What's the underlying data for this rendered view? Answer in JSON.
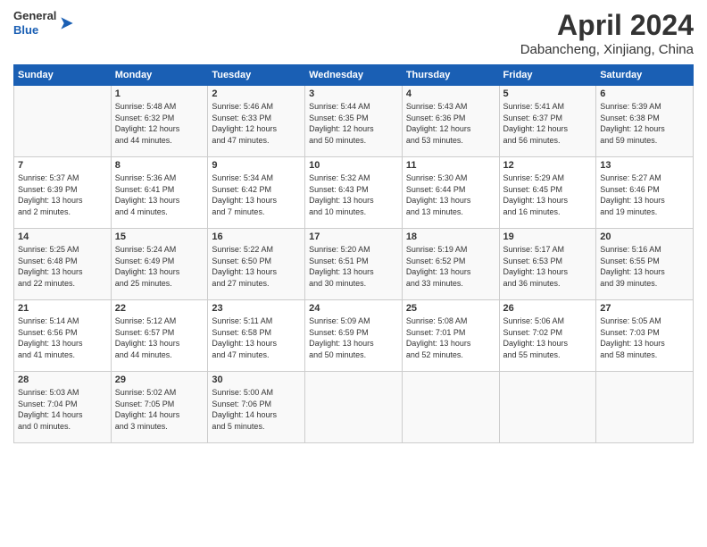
{
  "header": {
    "logo_general": "General",
    "logo_blue": "Blue",
    "month_title": "April 2024",
    "subtitle": "Dabancheng, Xinjiang, China"
  },
  "days_of_week": [
    "Sunday",
    "Monday",
    "Tuesday",
    "Wednesday",
    "Thursday",
    "Friday",
    "Saturday"
  ],
  "weeks": [
    [
      {
        "day": "",
        "content": ""
      },
      {
        "day": "1",
        "content": "Sunrise: 5:48 AM\nSunset: 6:32 PM\nDaylight: 12 hours\nand 44 minutes."
      },
      {
        "day": "2",
        "content": "Sunrise: 5:46 AM\nSunset: 6:33 PM\nDaylight: 12 hours\nand 47 minutes."
      },
      {
        "day": "3",
        "content": "Sunrise: 5:44 AM\nSunset: 6:35 PM\nDaylight: 12 hours\nand 50 minutes."
      },
      {
        "day": "4",
        "content": "Sunrise: 5:43 AM\nSunset: 6:36 PM\nDaylight: 12 hours\nand 53 minutes."
      },
      {
        "day": "5",
        "content": "Sunrise: 5:41 AM\nSunset: 6:37 PM\nDaylight: 12 hours\nand 56 minutes."
      },
      {
        "day": "6",
        "content": "Sunrise: 5:39 AM\nSunset: 6:38 PM\nDaylight: 12 hours\nand 59 minutes."
      }
    ],
    [
      {
        "day": "7",
        "content": "Sunrise: 5:37 AM\nSunset: 6:39 PM\nDaylight: 13 hours\nand 2 minutes."
      },
      {
        "day": "8",
        "content": "Sunrise: 5:36 AM\nSunset: 6:41 PM\nDaylight: 13 hours\nand 4 minutes."
      },
      {
        "day": "9",
        "content": "Sunrise: 5:34 AM\nSunset: 6:42 PM\nDaylight: 13 hours\nand 7 minutes."
      },
      {
        "day": "10",
        "content": "Sunrise: 5:32 AM\nSunset: 6:43 PM\nDaylight: 13 hours\nand 10 minutes."
      },
      {
        "day": "11",
        "content": "Sunrise: 5:30 AM\nSunset: 6:44 PM\nDaylight: 13 hours\nand 13 minutes."
      },
      {
        "day": "12",
        "content": "Sunrise: 5:29 AM\nSunset: 6:45 PM\nDaylight: 13 hours\nand 16 minutes."
      },
      {
        "day": "13",
        "content": "Sunrise: 5:27 AM\nSunset: 6:46 PM\nDaylight: 13 hours\nand 19 minutes."
      }
    ],
    [
      {
        "day": "14",
        "content": "Sunrise: 5:25 AM\nSunset: 6:48 PM\nDaylight: 13 hours\nand 22 minutes."
      },
      {
        "day": "15",
        "content": "Sunrise: 5:24 AM\nSunset: 6:49 PM\nDaylight: 13 hours\nand 25 minutes."
      },
      {
        "day": "16",
        "content": "Sunrise: 5:22 AM\nSunset: 6:50 PM\nDaylight: 13 hours\nand 27 minutes."
      },
      {
        "day": "17",
        "content": "Sunrise: 5:20 AM\nSunset: 6:51 PM\nDaylight: 13 hours\nand 30 minutes."
      },
      {
        "day": "18",
        "content": "Sunrise: 5:19 AM\nSunset: 6:52 PM\nDaylight: 13 hours\nand 33 minutes."
      },
      {
        "day": "19",
        "content": "Sunrise: 5:17 AM\nSunset: 6:53 PM\nDaylight: 13 hours\nand 36 minutes."
      },
      {
        "day": "20",
        "content": "Sunrise: 5:16 AM\nSunset: 6:55 PM\nDaylight: 13 hours\nand 39 minutes."
      }
    ],
    [
      {
        "day": "21",
        "content": "Sunrise: 5:14 AM\nSunset: 6:56 PM\nDaylight: 13 hours\nand 41 minutes."
      },
      {
        "day": "22",
        "content": "Sunrise: 5:12 AM\nSunset: 6:57 PM\nDaylight: 13 hours\nand 44 minutes."
      },
      {
        "day": "23",
        "content": "Sunrise: 5:11 AM\nSunset: 6:58 PM\nDaylight: 13 hours\nand 47 minutes."
      },
      {
        "day": "24",
        "content": "Sunrise: 5:09 AM\nSunset: 6:59 PM\nDaylight: 13 hours\nand 50 minutes."
      },
      {
        "day": "25",
        "content": "Sunrise: 5:08 AM\nSunset: 7:01 PM\nDaylight: 13 hours\nand 52 minutes."
      },
      {
        "day": "26",
        "content": "Sunrise: 5:06 AM\nSunset: 7:02 PM\nDaylight: 13 hours\nand 55 minutes."
      },
      {
        "day": "27",
        "content": "Sunrise: 5:05 AM\nSunset: 7:03 PM\nDaylight: 13 hours\nand 58 minutes."
      }
    ],
    [
      {
        "day": "28",
        "content": "Sunrise: 5:03 AM\nSunset: 7:04 PM\nDaylight: 14 hours\nand 0 minutes."
      },
      {
        "day": "29",
        "content": "Sunrise: 5:02 AM\nSunset: 7:05 PM\nDaylight: 14 hours\nand 3 minutes."
      },
      {
        "day": "30",
        "content": "Sunrise: 5:00 AM\nSunset: 7:06 PM\nDaylight: 14 hours\nand 5 minutes."
      },
      {
        "day": "",
        "content": ""
      },
      {
        "day": "",
        "content": ""
      },
      {
        "day": "",
        "content": ""
      },
      {
        "day": "",
        "content": ""
      }
    ]
  ]
}
